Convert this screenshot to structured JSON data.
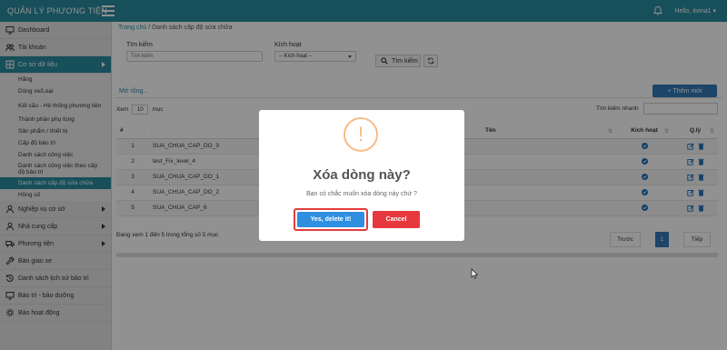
{
  "app": {
    "brand": "QUẢN LÝ PHƯƠNG TIỆN",
    "greeting": "Hello, itvina1 ▾",
    "accent_color": "#2a8ca0"
  },
  "sidebar": {
    "items": [
      {
        "label": "Dashboard",
        "icon": "monitor-icon"
      },
      {
        "label": "Tài khoản",
        "icon": "users-icon"
      },
      {
        "label": "Cơ sở dữ liệu",
        "icon": "table-icon",
        "active": true
      },
      {
        "label": "Nghiệp vụ cơ sở",
        "icon": "user-icon"
      },
      {
        "label": "Nhà cung cấp",
        "icon": "user-icon"
      },
      {
        "label": "Phương tiện",
        "icon": "truck-icon"
      },
      {
        "label": "Bàn giao xe",
        "icon": "wrench-icon"
      },
      {
        "label": "Danh sách lịch sử bảo trì",
        "icon": "history-icon"
      },
      {
        "label": "Báo trì - bảo dưỡng",
        "icon": "monitor-icon"
      },
      {
        "label": "Báo hoạt động",
        "icon": "gear-icon"
      }
    ],
    "submenu": [
      "Hãng",
      "Dòng xe/Loại",
      "Kết cấu - Hệ thống phương tiện",
      "Thành phần phụ tùng",
      "Sản phẩm / thiết bị",
      "Cấp độ bảo trì",
      "Danh sách công việc",
      "Danh sách công việc theo cấp độ bảo trì",
      "Danh sách cấp độ sửa chữa",
      "Hồng số"
    ]
  },
  "breadcrumb": {
    "home": "Trang chủ",
    "separator": "/",
    "current": "Danh sách cấp độ sửa chữa"
  },
  "filters": {
    "search_label": "Tìm kiếm",
    "search_placeholder": "Tìm kiếm",
    "active_label": "Kích hoạt",
    "active_value": "-- Kích hoạt --",
    "search_button": "Tìm kiếm",
    "more_link": "Mở rộng..."
  },
  "toolbar": {
    "add_button": "+ Thêm mới"
  },
  "table_controls": {
    "show_prefix": "Xem",
    "page_length": "10",
    "show_suffix": "mục",
    "quick_search_label": "Tìm kiếm nhanh"
  },
  "table": {
    "columns": [
      "#",
      "Tên",
      "Kích hoạt",
      "Q.lý"
    ],
    "rows": [
      {
        "index": "1",
        "name": "SUA_CHUA_CAP_DO_3"
      },
      {
        "index": "2",
        "name": "test_Fix_level_4"
      },
      {
        "index": "3",
        "name": "SUA_CHUA_CAP_DO_1"
      },
      {
        "index": "4",
        "name": "SUA_CHUA_CAP_DO_2"
      },
      {
        "index": "5",
        "name": "SUA_CHUA_CAP_6"
      }
    ],
    "info": "Đang xem 1 đến 5 trong tổng số 5 mục",
    "pagination": {
      "prev": "Trước",
      "current": "1",
      "next": "Tiếp"
    }
  },
  "modal": {
    "icon_symbol": "!",
    "title": "Xóa dòng này?",
    "text": "Bạn có chắc muốn xóa dòng này chứ ?",
    "confirm": "Yes, delete it!",
    "cancel": "Cancel"
  }
}
